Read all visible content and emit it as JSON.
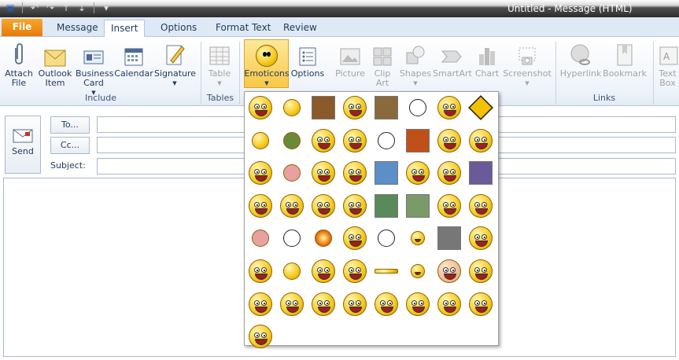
{
  "window": {
    "title": "Untitled  -  Message (HTML)"
  },
  "quick_access": [
    {
      "icon": "save-icon"
    },
    {
      "icon": "undo-icon"
    },
    {
      "icon": "redo-icon"
    },
    {
      "icon": "up-arrow-icon"
    },
    {
      "icon": "down-arrow-icon"
    },
    {
      "icon": "customize-qat-icon"
    }
  ],
  "tabs": {
    "file": "File",
    "message": "Message",
    "insert": "Insert",
    "options": "Options",
    "format_text": "Format Text",
    "review": "Review"
  },
  "ribbon": {
    "attach_file": "Attach\nFile",
    "outlook_item": "Outlook\nItem",
    "business_card": "Business\nCard",
    "calendar": "Calendar",
    "signature": "Signature",
    "table": "Table",
    "emoticons": "Emoticons",
    "options": "Options",
    "picture": "Picture",
    "clip_art": "Clip\nArt",
    "shapes": "Shapes",
    "smartart": "SmartArt",
    "chart": "Chart",
    "screenshot": "Screenshot",
    "hyperlink": "Hyperlink",
    "bookmark": "Bookmark",
    "text_box": "Text\nBox",
    "groups": {
      "include": "Include",
      "tables": "Tables",
      "links": "Links"
    }
  },
  "compose": {
    "send": "Send",
    "to": "To...",
    "cc": "Cc...",
    "subject": "Subject:"
  },
  "colors": {
    "accent_orange": "#f39c1a",
    "ribbon_blue": "#dfe9f5",
    "emoticon_yellow": "#f6c81a"
  },
  "emoticons": [
    "laughing-face",
    "surprised-figure",
    "dancing-guy",
    "worried-face",
    "monkey-picture",
    "stick-figure",
    "smirk-face",
    "warning-sign",
    "tiny-emotes",
    "green-alien",
    "squint-face",
    "thinking-face",
    "stickman",
    "fire-photo",
    "shy-face",
    "computer-guy",
    "soldier-face",
    "doll-figure",
    "wizard-face",
    "cool-face",
    "city-photo",
    "sweat-face",
    "crying-face",
    "tv-picture",
    "happy-face",
    "smile-face",
    "grin-face",
    "nose-face",
    "landscape-photo",
    "field-photo",
    "cheering-face",
    "waving-face",
    "angel-figure",
    "rage-face",
    "fireball",
    "shocked-face",
    "ghost-face",
    "small-face",
    "blurred-photo",
    "blush-face",
    "open-mouth-face",
    "ninja-face",
    "thumbs-up-face",
    "big-eyes-face",
    "beams",
    "tiny-face",
    "bald-face",
    "laughing-face-2",
    "squint-laugh-face",
    "grin-face-2",
    "shout-face",
    "happy-face-2",
    "meh-face",
    "joy-face",
    "joy-face-2",
    "gasp-face",
    "tongue-face"
  ]
}
